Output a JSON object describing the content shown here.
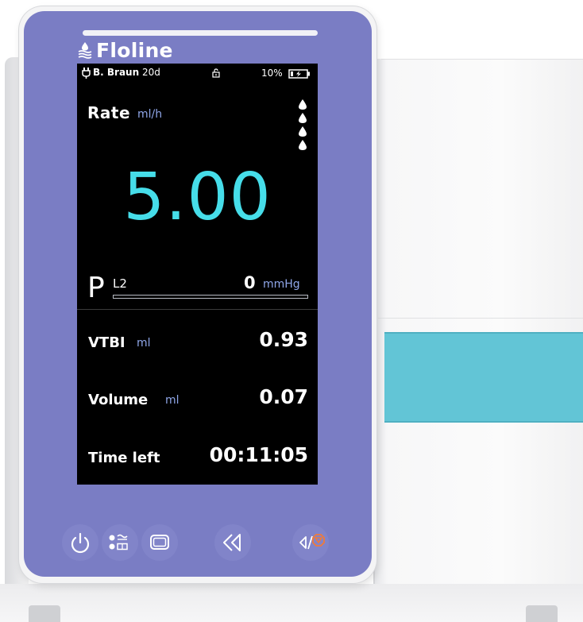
{
  "brand": {
    "name": "Floline",
    "logo_icon": "water-drop-logo-icon"
  },
  "status_bar": {
    "device_name": "B. Braun",
    "syringe_size": "20d",
    "battery_percent": "10%",
    "icons": [
      "plug-icon",
      "unlocked-padlock-icon",
      "battery-charging-icon"
    ]
  },
  "rate": {
    "label": "Rate",
    "unit": "ml/h",
    "value": "5.00",
    "drops_icon": "drop-rate-icon"
  },
  "pressure": {
    "label": "P",
    "level": "L2",
    "value": "0",
    "unit": "mmHg",
    "bar_fraction": 0.0
  },
  "rows": [
    {
      "label": "VTBI",
      "unit": "ml",
      "value": "0.93"
    },
    {
      "label": "Volume",
      "unit": "ml",
      "value": "0.07"
    },
    {
      "label": "Time left",
      "unit": "",
      "value": "00:11:05"
    }
  ],
  "keys": [
    {
      "name": "power-key",
      "icon": "power-icon"
    },
    {
      "name": "menu-key",
      "icon": "options-menu-icon"
    },
    {
      "name": "display-key",
      "icon": "screen-icon"
    },
    {
      "name": "bolus-key",
      "icon": "rewind-icon"
    },
    {
      "name": "start-stop-key",
      "icon": "start-stop-icon"
    }
  ],
  "colors": {
    "panel": "#7a7dc4",
    "screen_bg": "#000000",
    "rate_value": "#46dde9",
    "unit_text": "#8fa6e8",
    "stop_accent": "#f07a3a",
    "cyan_band": "#62c5d6"
  }
}
